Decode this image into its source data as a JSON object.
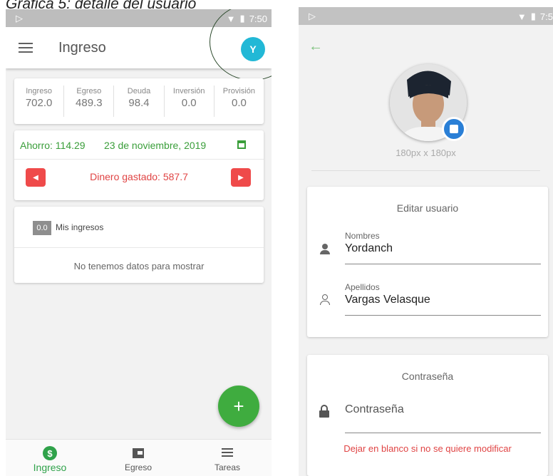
{
  "caption": "Gráfica 5: detalle del usuario",
  "left": {
    "status_time": "7:50",
    "title": "Ingreso",
    "avatar_letter": "Y",
    "stats": [
      {
        "label": "Ingreso",
        "value": "702.0"
      },
      {
        "label": "Egreso",
        "value": "489.3"
      },
      {
        "label": "Deuda",
        "value": "98.4"
      },
      {
        "label": "Inversión",
        "value": "0.0"
      },
      {
        "label": "Provisión",
        "value": "0.0"
      }
    ],
    "ahorro": "Ahorro: 114.29",
    "date": "23 de noviembre, 2019",
    "spent": "Dinero gastado: 587.7",
    "ingresos_badge": "0.0",
    "ingresos_title": "Mis ingresos",
    "empty_text": "No tenemos datos para mostrar",
    "fab": "+",
    "nav": [
      {
        "label": "Ingreso",
        "icon": "dollar-icon"
      },
      {
        "label": "Egreso",
        "icon": "wallet-icon"
      },
      {
        "label": "Tareas",
        "icon": "list-icon"
      }
    ]
  },
  "right": {
    "status_time": "7:5",
    "photo_size": "180px x 180px",
    "edit_title": "Editar usuario",
    "first_name_label": "Nombres",
    "first_name_value": "Yordanch",
    "last_name_label": "Apellidos",
    "last_name_value": "Vargas Velasque",
    "password_title": "Contraseña",
    "password_placeholder": "Contraseña",
    "password_hint": "Dejar en blanco si no se quiere modificar"
  },
  "colors": {
    "green": "#3a9e3a",
    "red": "#e04444",
    "avatar": "#22b8d6"
  }
}
